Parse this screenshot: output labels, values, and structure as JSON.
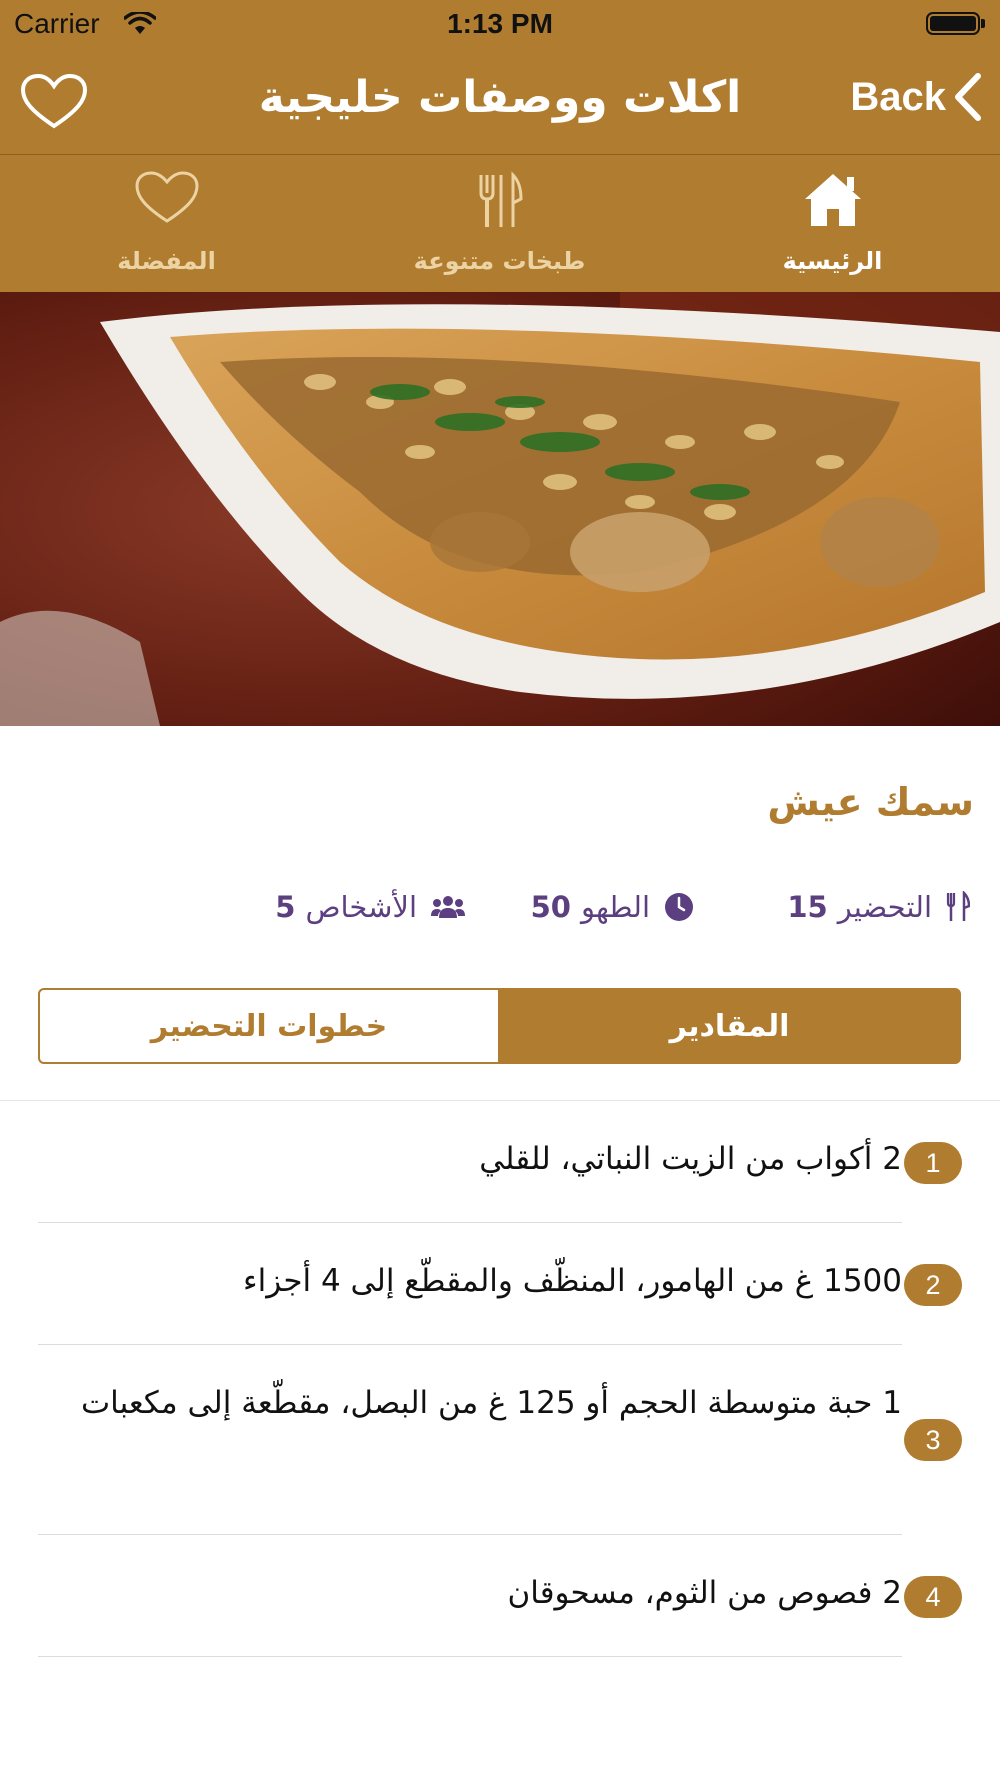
{
  "status_bar": {
    "carrier": "Carrier",
    "time": "1:13 PM"
  },
  "nav": {
    "title": "اكلات ووصفات خليجية",
    "back_label": "Back"
  },
  "tabs": [
    {
      "label": "المفضلة",
      "icon": "heart-outline-icon",
      "active": false
    },
    {
      "label": "طبخات متنوعة",
      "icon": "fork-knife-icon",
      "active": false
    },
    {
      "label": "الرئيسية",
      "icon": "home-icon",
      "active": true
    }
  ],
  "hero": {
    "description_icon": "fish-and-rice-dish-photo"
  },
  "recipe": {
    "title": "سمك عيش",
    "prep_label": "التحضير",
    "prep_value": "15",
    "cook_label": "الطهو",
    "cook_value": "50",
    "servings_label": "الأشخاص",
    "servings_value": "5"
  },
  "segments": {
    "ingredients": "المقادير",
    "steps": "خطوات التحضير"
  },
  "ingredients": [
    {
      "num": "1",
      "text": "2 أكواب من الزيت النباتي، للقلي"
    },
    {
      "num": "2",
      "text": "1500 غ من الهامور، المنظّف والمقطّع إلى 4 أجزاء"
    },
    {
      "num": "3",
      "text": "1 حبة متوسطة الحجم أو 125 غ من البصل، مقطّعة إلى مكعبات"
    },
    {
      "num": "4",
      "text": "2 فصوص من الثوم، مسحوقان"
    }
  ],
  "colors": {
    "accent": "#b07c2f",
    "meta": "#5c3f80"
  }
}
